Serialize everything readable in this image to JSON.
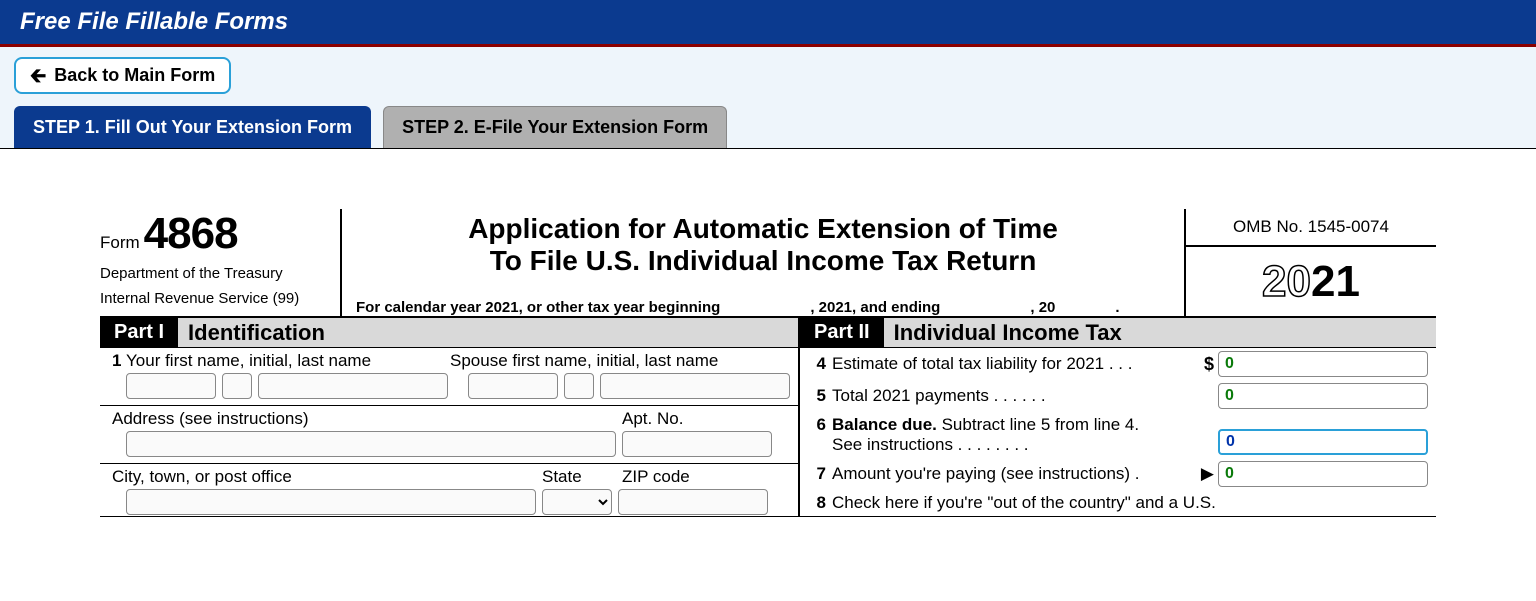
{
  "header": {
    "title": "Free File Fillable Forms"
  },
  "nav": {
    "back": "Back to Main Form"
  },
  "tabs": [
    {
      "label": "STEP 1. Fill Out Your Extension Form",
      "active": true
    },
    {
      "label": "STEP 2. E-File Your Extension Form",
      "active": false
    }
  ],
  "form": {
    "form_label": "Form",
    "form_number": "4868",
    "dept1": "Department of the Treasury",
    "dept2": "Internal Revenue Service (99)",
    "title1": "Application for Automatic Extension of Time",
    "title2": "To File U.S. Individual Income Tax Return",
    "cal_prefix": "For calendar year 2021, or other tax year beginning",
    "cal_mid": ", 2021, and ending",
    "cal_suffix": ", 20",
    "omb": "OMB No. 1545-0074",
    "year_outline": "20",
    "year_solid": "21",
    "part1": {
      "badge": "Part I",
      "title": "Identification",
      "l1_num": "1",
      "l1_self": "Your first name, initial, last name",
      "l1_spouse": "Spouse first name, initial, last name",
      "l_addr": "Address (see instructions)",
      "l_apt": "Apt. No.",
      "l_city": "City, town, or post office",
      "l_state": "State",
      "l_zip": "ZIP code"
    },
    "part2": {
      "badge": "Part II",
      "title": "Individual Income Tax",
      "l4_num": "4",
      "l4_text": "Estimate of total tax liability for 2021 .    .    .",
      "l4_val": "0",
      "l5_num": "5",
      "l5_text": "Total 2021 payments     .     .     .     .     .     .",
      "l5_val": "0",
      "l6_num": "6",
      "l6_text1": "Balance due.",
      "l6_text2": " Subtract line 5 from line 4.",
      "l6_text3": "See instructions    .     .     .     .     .     .     .     .",
      "l6_val": "0",
      "l7_num": "7",
      "l7_text": "Amount you're paying (see instructions) .",
      "l7_val": "0",
      "l8_num": "8",
      "l8_text": "Check here if you're \"out of the country\" and a U.S."
    }
  }
}
